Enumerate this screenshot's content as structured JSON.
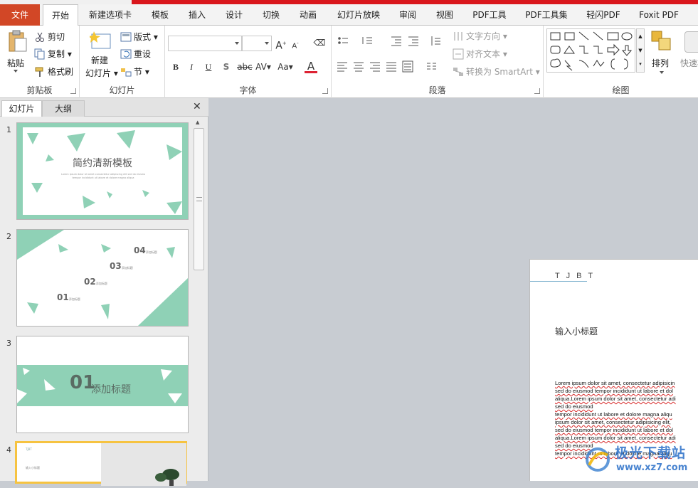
{
  "ribbon_tabs": [
    "文件",
    "开始",
    "新建选项卡",
    "模板",
    "插入",
    "设计",
    "切换",
    "动画",
    "幻灯片放映",
    "审阅",
    "视图",
    "PDF工具",
    "PDF工具集",
    "轻闪PDF",
    "Foxit PDF"
  ],
  "clipboard": {
    "paste": "粘贴",
    "cut": "剪切",
    "copy": "复制",
    "format_painter": "格式刷",
    "label": "剪贴板"
  },
  "slides_group": {
    "new_slide_line1": "新建",
    "new_slide_line2": "幻灯片",
    "layout": "版式",
    "reset": "重设",
    "section": "节",
    "label": "幻灯片"
  },
  "font_group": {
    "label": "字体",
    "bold": "B",
    "italic": "I",
    "underline": "U",
    "shadow": "S",
    "strike": "abc",
    "spacing": "AV",
    "case": "Aa",
    "color": "A",
    "grow": "A",
    "shrink": "A"
  },
  "paragraph_group": {
    "text_direction": "文字方向",
    "align_text": "对齐文本",
    "convert_smartart": "转换为 SmartArt",
    "label": "段落"
  },
  "drawing_group": {
    "arrange": "排列",
    "quick_styles": "快速样",
    "label": "绘图"
  },
  "panel": {
    "tab_slides": "幻灯片",
    "tab_outline": "大纲",
    "close": "✕"
  },
  "thumbnails": [
    {
      "num": "1",
      "title": "简约清新模板",
      "sub1": "Lorem ipsum dolor sit amet consectetur adipiscing elit sed do eiusmod",
      "sub2": "tempor incididunt ut labore et dolore magna aliqua"
    },
    {
      "num": "2",
      "items": [
        {
          "n": "04",
          "t": "添加标题"
        },
        {
          "n": "03",
          "t": "添加标题"
        },
        {
          "n": "02",
          "t": "添加标题"
        },
        {
          "n": "01",
          "t": "添加标题"
        }
      ]
    },
    {
      "num": "3",
      "n": "01",
      "title": "添加标题"
    },
    {
      "num": "4",
      "header": "TJBT",
      "sub": "输入小标题"
    }
  ],
  "slide": {
    "header": "T J B T",
    "subtitle": "输入小标题",
    "lines": [
      "Lorem ipsum dolor sit amet, consectetur adipisicin",
      "sed do eiusmod tempor incididunt ut labore et dol",
      "aliqua.Lorem ipsum dolor sit amet, consectetur adi",
      "sed do eiusmod",
      "tempor incididunt ut labore et dolore magna aliqu",
      "ipsum dolor sit amet, consectetur adipisicing elit,",
      "sed do eiusmod tempor incididunt ut labore et dol",
      "aliqua.Lorem ipsum dolor sit amet, consectetur adi",
      "sed do eiusmod",
      "tempor incididunt ut labore et dolore magna aliqu"
    ]
  },
  "watermark": {
    "brand": "极光下载站",
    "url": "www.xz7.com"
  },
  "colors": {
    "accent": "#d24726",
    "mint": "#8fd1b6",
    "select": "#f6c341"
  }
}
